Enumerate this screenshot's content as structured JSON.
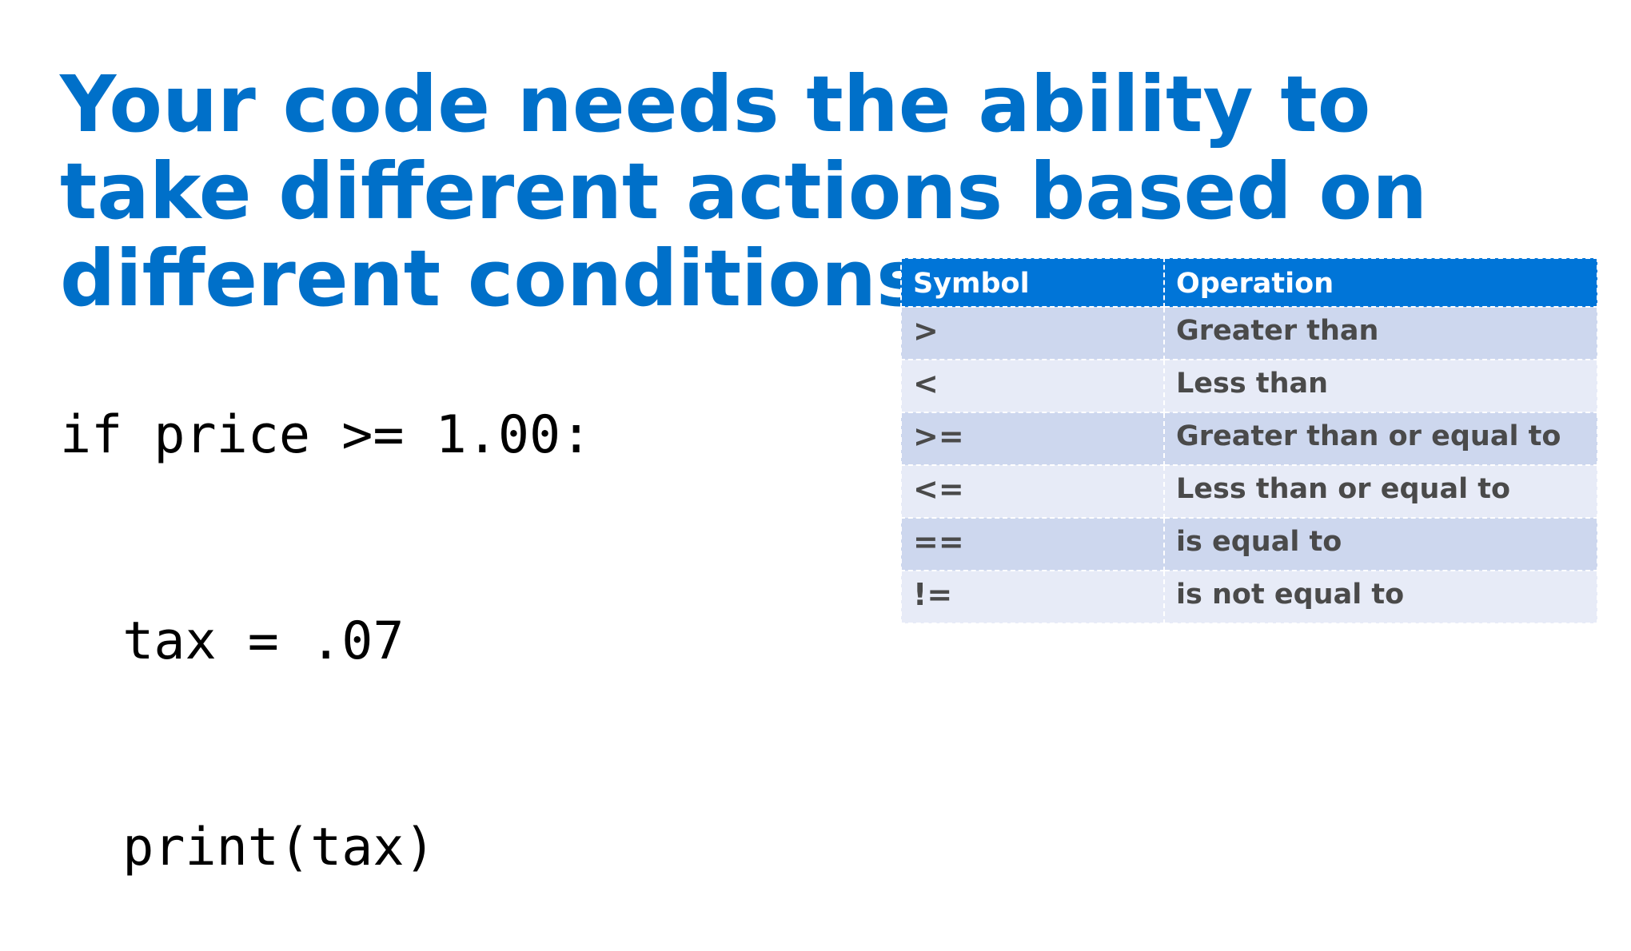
{
  "slide": {
    "title_lines": [
      "Your code needs the ability to",
      "take different actions based on",
      "different conditions"
    ],
    "code_lines": [
      "if price >= 1.00:",
      "  tax = .07",
      "  print(tax)"
    ]
  },
  "table": {
    "headers": [
      "Symbol",
      "Operation"
    ],
    "rows": [
      {
        "symbol": ">",
        "operation": "Greater than"
      },
      {
        "symbol": "<",
        "operation": "Less than"
      },
      {
        "symbol": ">=",
        "operation": "Greater than or equal to"
      },
      {
        "symbol": "<=",
        "operation": "Less than or equal to"
      },
      {
        "symbol": "==",
        "operation": "is equal to"
      },
      {
        "symbol": "!=",
        "operation": "is not equal to"
      }
    ]
  },
  "colors": {
    "title": "#0070C9",
    "table_header_bg": "#0075D8",
    "row_odd_bg": "#CDD7EE",
    "row_even_bg": "#E7EBF7",
    "row_text": "#4a4a4a"
  }
}
